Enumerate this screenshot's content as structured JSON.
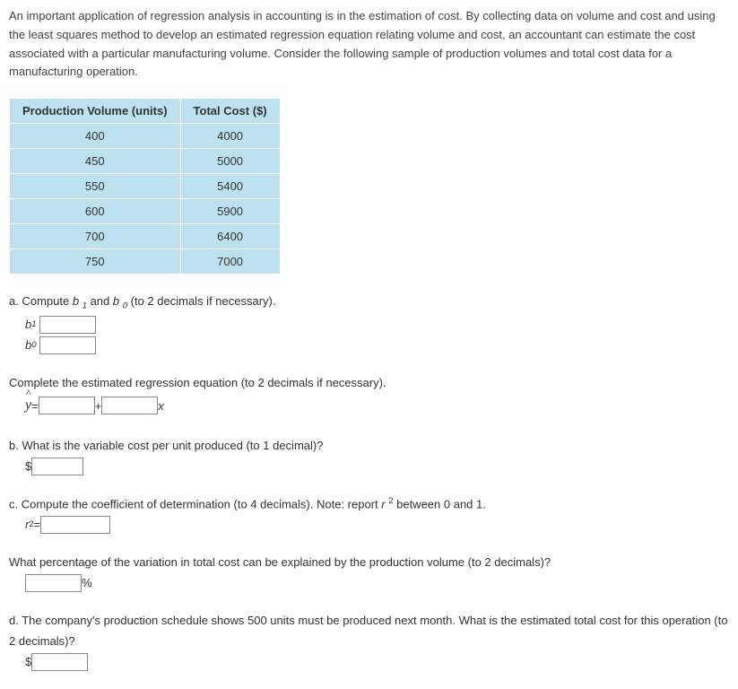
{
  "intro": "An important application of regression analysis in accounting is in the estimation of cost. By collecting data on volume and cost and using the least squares method to develop an estimated regression equation relating volume and cost, an accountant can estimate the cost associated with a particular manufacturing volume. Consider the following sample of production volumes and total cost data for a manufacturing operation.",
  "table": {
    "headers": {
      "col1": "Production Volume (units)",
      "col2": "Total Cost ($)"
    },
    "rows": [
      {
        "v": "400",
        "c": "4000"
      },
      {
        "v": "450",
        "c": "5000"
      },
      {
        "v": "550",
        "c": "5400"
      },
      {
        "v": "600",
        "c": "5900"
      },
      {
        "v": "700",
        "c": "6400"
      },
      {
        "v": "750",
        "c": "7000"
      }
    ]
  },
  "qa": {
    "prompt": "a. Compute ",
    "prompt_tail": " (to 2 decimals if necessary).",
    "b1_label": "b ",
    "b1_sub": "1",
    "and": " and ",
    "b0_label": "b ",
    "b0_sub": "0"
  },
  "eq_prompt": "Complete the estimated regression equation (to 2 decimals if necessary).",
  "eq": {
    "yhat": "y",
    "equals": " = ",
    "plus": " + ",
    "x": " x"
  },
  "qb": {
    "prompt": "b. What is the variable cost per unit produced (to 1 decimal)?",
    "prefix": "$"
  },
  "qc": {
    "prompt_head": "c. Compute the coefficient of determination (to 4 decimals). Note: report ",
    "r": "r ",
    "sup2": "2",
    "prompt_tail": " between 0 and 1.",
    "label_r": "r ",
    "label_sup": "2",
    "label_eq": " = "
  },
  "qc2": {
    "prompt": "What percentage of the variation in total cost can be explained by the production volume (to 2 decimals)?",
    "suffix": " %"
  },
  "qd": {
    "prompt": "d. The company's production schedule shows 500 units must be produced next month. What is the estimated total cost for this operation (to 2 decimals)?",
    "prefix": "$"
  },
  "chart_data": {
    "type": "table",
    "columns": [
      "Production Volume (units)",
      "Total Cost ($)"
    ],
    "rows": [
      [
        400,
        4000
      ],
      [
        450,
        5000
      ],
      [
        550,
        5400
      ],
      [
        600,
        5900
      ],
      [
        700,
        6400
      ],
      [
        750,
        7000
      ]
    ]
  }
}
